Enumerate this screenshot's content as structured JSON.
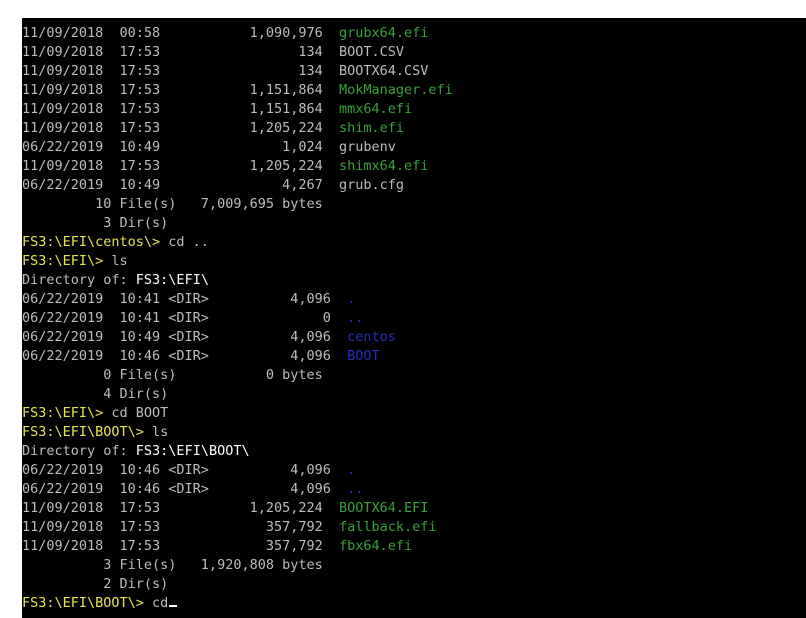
{
  "colors": {
    "default_text": "#bdbdbd",
    "executable": "#3aa03a",
    "directory": "#2a2ac0",
    "prompt": "#e6e64a",
    "path_highlight": "#ffffff",
    "background": "#000000"
  },
  "terminal": {
    "lines": [
      [
        {
          "text": "11/09/2018  00:58           1,090,976  ",
          "color": "default"
        },
        {
          "text": "grubx64.efi",
          "color": "green"
        }
      ],
      [
        {
          "text": "11/09/2018  17:53                 134  BOOT.CSV",
          "color": "default"
        }
      ],
      [
        {
          "text": "11/09/2018  17:53                 134  BOOTX64.CSV",
          "color": "default"
        }
      ],
      [
        {
          "text": "11/09/2018  17:53           1,151,864  ",
          "color": "default"
        },
        {
          "text": "MokManager.efi",
          "color": "green"
        }
      ],
      [
        {
          "text": "11/09/2018  17:53           1,151,864  ",
          "color": "default"
        },
        {
          "text": "mmx64.efi",
          "color": "green"
        }
      ],
      [
        {
          "text": "11/09/2018  17:53           1,205,224  ",
          "color": "default"
        },
        {
          "text": "shim.efi",
          "color": "green"
        }
      ],
      [
        {
          "text": "06/22/2019  10:49               1,024  grubenv",
          "color": "default"
        }
      ],
      [
        {
          "text": "11/09/2018  17:53           1,205,224  ",
          "color": "default"
        },
        {
          "text": "shimx64.efi",
          "color": "green"
        }
      ],
      [
        {
          "text": "06/22/2019  10:49               4,267  grub.cfg",
          "color": "default"
        }
      ],
      [
        {
          "text": "         10 File(s)   7,009,695 bytes",
          "color": "default"
        }
      ],
      [
        {
          "text": "          3 Dir(s)",
          "color": "default"
        }
      ],
      [
        {
          "text": "FS3:\\EFI\\centos\\>",
          "color": "yellow"
        },
        {
          "text": " cd ..",
          "color": "default"
        }
      ],
      [
        {
          "text": "FS3:\\EFI\\>",
          "color": "yellow"
        },
        {
          "text": " ls",
          "color": "default"
        }
      ],
      [
        {
          "text": "Directory of: ",
          "color": "default"
        },
        {
          "text": "FS3:\\EFI\\",
          "color": "white"
        }
      ],
      [
        {
          "text": "06/22/2019  10:41 <DIR>          4,096  ",
          "color": "default"
        },
        {
          "text": ".",
          "color": "blue"
        }
      ],
      [
        {
          "text": "06/22/2019  10:41 <DIR>              0  ",
          "color": "default"
        },
        {
          "text": "..",
          "color": "blue"
        }
      ],
      [
        {
          "text": "06/22/2019  10:49 <DIR>          4,096  ",
          "color": "default"
        },
        {
          "text": "centos",
          "color": "blue"
        }
      ],
      [
        {
          "text": "06/22/2019  10:46 <DIR>          4,096  ",
          "color": "default"
        },
        {
          "text": "BOOT",
          "color": "blue"
        }
      ],
      [
        {
          "text": "          0 File(s)           0 bytes",
          "color": "default"
        }
      ],
      [
        {
          "text": "          4 Dir(s)",
          "color": "default"
        }
      ],
      [
        {
          "text": "FS3:\\EFI\\>",
          "color": "yellow"
        },
        {
          "text": " cd BOOT",
          "color": "default"
        }
      ],
      [
        {
          "text": "FS3:\\EFI\\BOOT\\>",
          "color": "yellow"
        },
        {
          "text": " ls",
          "color": "default"
        }
      ],
      [
        {
          "text": "Directory of: ",
          "color": "default"
        },
        {
          "text": "FS3:\\EFI\\BOOT\\",
          "color": "white"
        }
      ],
      [
        {
          "text": "06/22/2019  10:46 <DIR>          4,096  ",
          "color": "default"
        },
        {
          "text": ".",
          "color": "blue"
        }
      ],
      [
        {
          "text": "06/22/2019  10:46 <DIR>          4,096  ",
          "color": "default"
        },
        {
          "text": "..",
          "color": "blue"
        }
      ],
      [
        {
          "text": "11/09/2018  17:53           1,205,224  ",
          "color": "default"
        },
        {
          "text": "BOOTX64.EFI",
          "color": "green"
        }
      ],
      [
        {
          "text": "11/09/2018  17:53             357,792  ",
          "color": "default"
        },
        {
          "text": "fallback.efi",
          "color": "green"
        }
      ],
      [
        {
          "text": "11/09/2018  17:53             357,792  ",
          "color": "default"
        },
        {
          "text": "fbx64.efi",
          "color": "green"
        }
      ],
      [
        {
          "text": "          3 File(s)   1,920,808 bytes",
          "color": "default"
        }
      ],
      [
        {
          "text": "          2 Dir(s)",
          "color": "default"
        }
      ],
      [
        {
          "text": "FS3:\\EFI\\BOOT\\>",
          "color": "yellow"
        },
        {
          "text": " cd",
          "color": "default"
        }
      ]
    ],
    "cursor_visible": true
  }
}
